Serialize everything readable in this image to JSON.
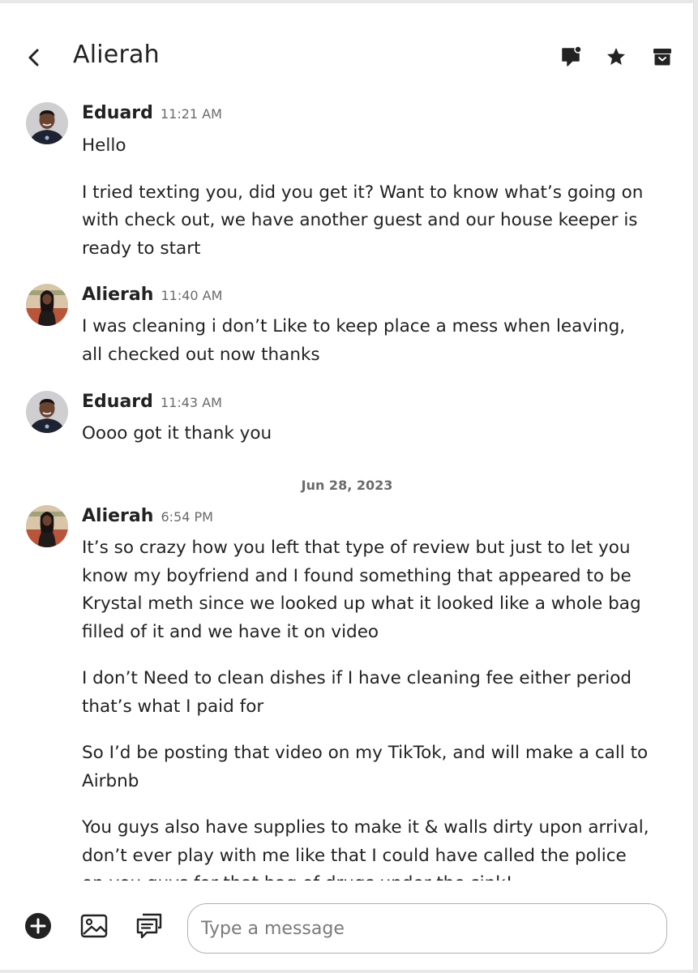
{
  "header": {
    "title": "Alierah"
  },
  "icons": {
    "back": "chevron-left-icon",
    "translate": "chat-bubble-icon",
    "star": "star-icon",
    "archive": "archive-icon",
    "add": "plus-circle-icon",
    "image": "image-icon",
    "quick_replies": "message-bubbles-icon"
  },
  "colors": {
    "text": "#222222",
    "muted": "#6a6a6a",
    "border": "#b0b0b0"
  },
  "messages": [
    {
      "sender": "Eduard",
      "time": "11:21 AM",
      "paragraphs": [
        "Hello",
        "I tried texting you, did you get it? Want to know what’s going on with check out, we have another guest and our house keeper is ready to start"
      ]
    },
    {
      "sender": "Alierah",
      "time": "11:40 AM",
      "paragraphs": [
        "I was cleaning i don’t Like to keep place a mess when leaving, all checked out now thanks"
      ]
    },
    {
      "sender": "Eduard",
      "time": "11:43 AM",
      "paragraphs": [
        "Oooo got it thank you"
      ]
    },
    {
      "sender": "Alierah",
      "time": "6:54 PM",
      "paragraphs": [
        "It’s so crazy how you left that type of review but just to let you know my boyfriend and I found something that appeared to be Krystal meth since we looked up what it looked like a whole bag filled of it and we have it on video",
        "I don’t Need to clean dishes if I have cleaning fee either period that’s what I paid for",
        "So I’d be posting that video on my TikTok, and will make a call to Airbnb",
        "You guys also have supplies to make it & walls dirty upon arrival, don’t ever play with me like that I could have called the police on you guys for that bag of drugs under the sink!"
      ]
    }
  ],
  "date_separator": "Jun 28, 2023",
  "composer": {
    "placeholder": "Type a message",
    "value": ""
  }
}
